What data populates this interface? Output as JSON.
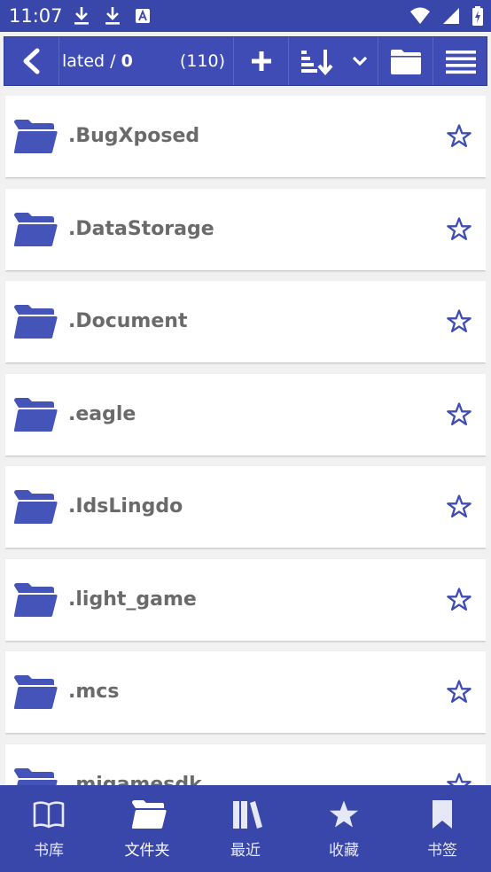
{
  "status_bar": {
    "time": "11:07",
    "left_icons": [
      "download-icon",
      "download-icon",
      "font-icon"
    ],
    "right_icons": [
      "wifi-icon",
      "signal-icon",
      "battery-charging-icon"
    ]
  },
  "toolbar": {
    "path": "lated / 0",
    "path_prefix": "lated / ",
    "path_current": "0",
    "count": "(110)",
    "icons": [
      "back-chevron-icon",
      "plus-icon",
      "sort-descending-icon",
      "chevron-down-icon",
      "folder-icon",
      "hamburger-menu-icon"
    ]
  },
  "folders": [
    {
      "name": ".BugXposed"
    },
    {
      "name": ".DataStorage"
    },
    {
      "name": ".Document"
    },
    {
      "name": ".eagle"
    },
    {
      "name": ".IdsLingdo"
    },
    {
      "name": ".light_game"
    },
    {
      "name": ".mcs"
    },
    {
      "name": ".migamesdk"
    }
  ],
  "bottom_nav": {
    "items": [
      {
        "label": "书库",
        "icon": "open-book-icon"
      },
      {
        "label": "文件夹",
        "icon": "folder-open-icon",
        "active": true
      },
      {
        "label": "最近",
        "icon": "books-icon"
      },
      {
        "label": "收藏",
        "icon": "star-icon"
      },
      {
        "label": "书签",
        "icon": "bookmark-icon"
      }
    ]
  },
  "colors": {
    "primary": "#3a47aa",
    "toolbar": "#3f4cb5",
    "folder_icon": "#4554b8",
    "star_outline": "#3f4cb5",
    "row_text": "#6a6a6a",
    "background": "#f1f1f1"
  }
}
